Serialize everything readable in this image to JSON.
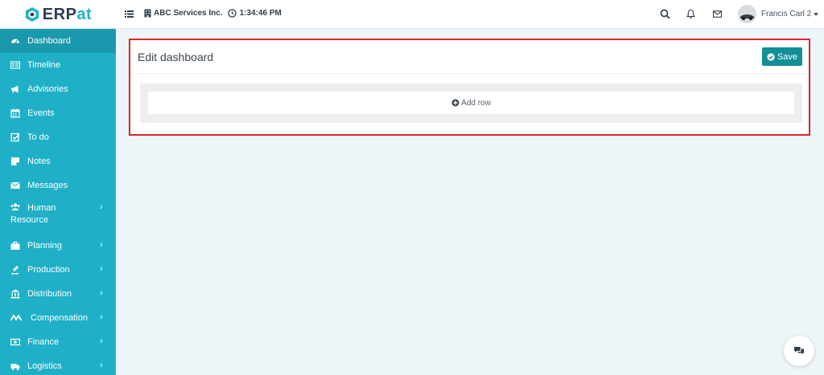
{
  "app": {
    "logo_text_main": "ERP",
    "logo_text_accent": "at"
  },
  "header": {
    "company": "ABC Services Inc.",
    "time": "1:34:46 PM",
    "user_name": "Francis Carl 2"
  },
  "sidebar": {
    "items": [
      {
        "label": "Dashboard",
        "icon": "dashboard-icon",
        "active": true
      },
      {
        "label": "Timeline",
        "icon": "timeline-icon"
      },
      {
        "label": "Advisories",
        "icon": "megaphone-icon"
      },
      {
        "label": "Events",
        "icon": "calendar-icon"
      },
      {
        "label": "To do",
        "icon": "checkbox-icon"
      },
      {
        "label": "Notes",
        "icon": "sticky-note-icon"
      },
      {
        "label": "Messages",
        "icon": "envelope-icon"
      },
      {
        "label": "Human Resource",
        "icon": "users-icon",
        "submenu": true
      },
      {
        "label": "Planning",
        "icon": "briefcase-icon",
        "submenu": true
      },
      {
        "label": "Production",
        "icon": "flask-icon",
        "submenu": true
      },
      {
        "label": "Distribution",
        "icon": "bank-icon",
        "submenu": true
      },
      {
        "label": "Compensation",
        "icon": "money-icon",
        "submenu": true
      },
      {
        "label": "Finance",
        "icon": "money-bill-icon",
        "submenu": true
      },
      {
        "label": "Logistics",
        "icon": "truck-icon",
        "submenu": true
      }
    ]
  },
  "main": {
    "title": "Edit dashboard",
    "save_label": "Save",
    "add_row_label": "Add row"
  },
  "colors": {
    "sidebar": "#1fb0c7",
    "sidebar_active": "#1a98ad",
    "save_button": "#138f96",
    "highlight_border": "#e0222c"
  }
}
